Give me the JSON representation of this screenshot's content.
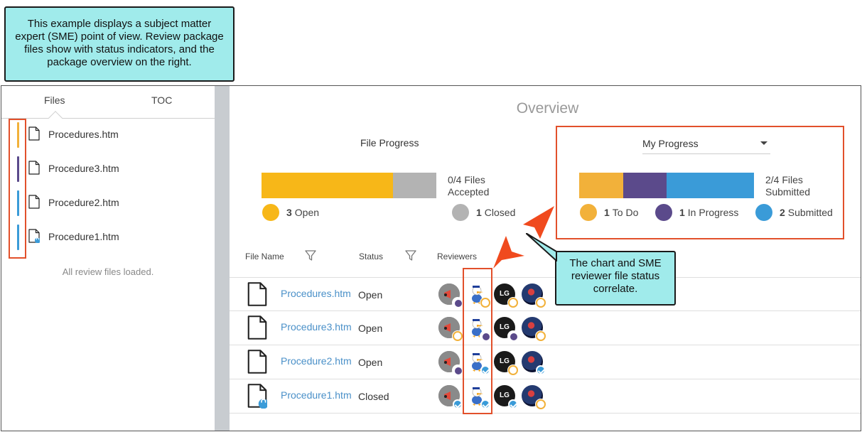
{
  "callouts": {
    "top": "This example displays a subject matter expert (SME) point of view. Review package files show with status indicators, and the package overview on the right.",
    "middle": "The chart and SME reviewer file status correlate."
  },
  "left": {
    "tabs": {
      "files": "Files",
      "toc": "TOC"
    },
    "files": [
      {
        "name": "Procedures.htm",
        "color": "#f2b13a",
        "locked": false
      },
      {
        "name": "Procedure3.htm",
        "color": "#5b4a8b",
        "locked": false
      },
      {
        "name": "Procedure2.htm",
        "color": "#3a9bd8",
        "locked": false
      },
      {
        "name": "Procedure1.htm",
        "color": "#3a9bd8",
        "locked": true
      }
    ],
    "loaded_message": "All review files loaded."
  },
  "overview": {
    "title": "Overview",
    "file_progress": {
      "title": "File Progress",
      "summary_line1": "0/4 Files",
      "summary_line2": "Accepted",
      "open_count": "3",
      "open_label": "Open",
      "closed_count": "1",
      "closed_label": "Closed",
      "open_fraction": 0.75,
      "closed_fraction": 0.25
    },
    "my_progress": {
      "dropdown_value": "My Progress",
      "summary_line1": "2/4 Files",
      "summary_line2": "Submitted",
      "todo_count": "1",
      "todo_label": "To Do",
      "inprogress_count": "1",
      "inprogress_label": "In Progress",
      "submitted_count": "2",
      "submitted_label": "Submitted",
      "todo_fraction": 0.25,
      "inprogress_fraction": 0.25,
      "submitted_fraction": 0.5
    }
  },
  "table": {
    "headers": {
      "file_name": "File Name",
      "status": "Status",
      "reviewers": "Reviewers"
    },
    "rows": [
      {
        "name": "Procedures.htm",
        "status": "Open",
        "locked": false,
        "reviewers": [
          "inprog",
          "todo",
          "todo",
          "todo"
        ]
      },
      {
        "name": "Procedure3.htm",
        "status": "Open",
        "locked": false,
        "reviewers": [
          "todo",
          "inprog",
          "inprog",
          "todo"
        ]
      },
      {
        "name": "Procedure2.htm",
        "status": "Open",
        "locked": false,
        "reviewers": [
          "inprog",
          "sub",
          "todo",
          "sub"
        ]
      },
      {
        "name": "Procedure1.htm",
        "status": "Closed",
        "locked": true,
        "reviewers": [
          "sub",
          "sub",
          "sub",
          "todo"
        ]
      }
    ],
    "reviewer_initials": "LG"
  },
  "colors": {
    "todo": "#f2b13a",
    "inprogress": "#5b4a8b",
    "submitted": "#3a9bd8",
    "open": "#f7b718",
    "closed": "#b3b3b3",
    "highlight": "#e2502b",
    "callout_bg": "#a0ebeb"
  }
}
